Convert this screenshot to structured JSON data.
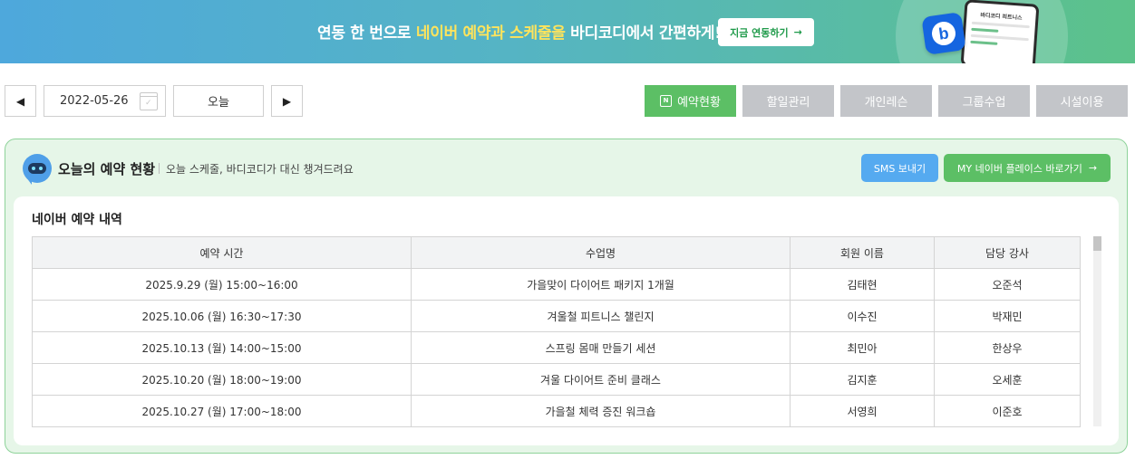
{
  "banner": {
    "text_before": "연동 한 번으로 ",
    "text_highlight": "네이버 예약과 스케줄을",
    "text_after": " 바디코디에서 간편하게!",
    "button_label": "지금 연동하기",
    "phone_title": "바디코디 피트니스",
    "logo_letter": "b"
  },
  "toolbar": {
    "prev_icon": "◀",
    "date_value": "2022-05-26",
    "today_label": "오늘",
    "next_icon": "▶",
    "tabs": [
      {
        "label": "예약현황",
        "active": true,
        "icon": "N"
      },
      {
        "label": "할일관리",
        "active": false
      },
      {
        "label": "개인레슨",
        "active": false
      },
      {
        "label": "그룹수업",
        "active": false
      },
      {
        "label": "시설이용",
        "active": false
      }
    ]
  },
  "panel": {
    "title": "오늘의 예약 현황",
    "subtitle": "오늘 스케줄, 바디코디가 대신 챙겨드려요",
    "sms_button": "SMS 보내기",
    "place_button": "MY 네이버 플레이스 바로가기"
  },
  "reservations": {
    "title": "네이버 예약 내역",
    "columns": [
      "예약 시간",
      "수업명",
      "회원 이름",
      "담당 강사"
    ],
    "rows": [
      [
        "2025.9.29 (월) 15:00~16:00",
        "가을맞이 다이어트 패키지 1개월",
        "김태현",
        "오준석"
      ],
      [
        "2025.10.06 (월) 16:30~17:30",
        "겨울철 피트니스 챌린지",
        "이수진",
        "박재민"
      ],
      [
        "2025.10.13 (월) 14:00~15:00",
        "스프링 몸매 만들기 세션",
        "최민아",
        "한상우"
      ],
      [
        "2025.10.20 (월) 18:00~19:00",
        "겨울 다이어트 준비 클래스",
        "김지훈",
        "오세훈"
      ],
      [
        "2025.10.27 (월) 17:00~18:00",
        "가을철 체력 증진 워크숍",
        "서영희",
        "이준호"
      ]
    ]
  },
  "colors": {
    "accent_green": "#5cbf65",
    "sms_blue": "#55aaf0",
    "tab_inactive": "#c3c5c9",
    "highlight_yellow": "#ffe45c"
  }
}
